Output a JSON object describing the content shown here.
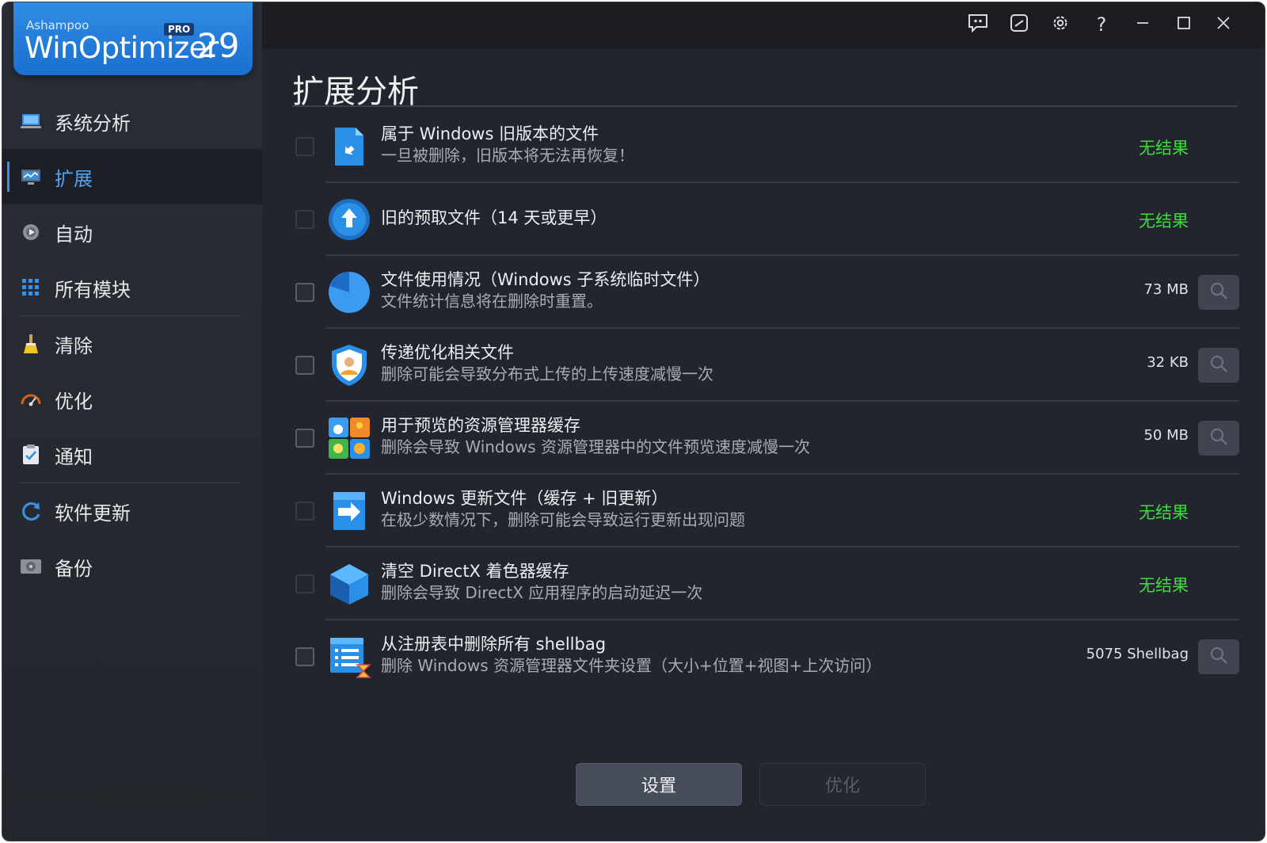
{
  "app": {
    "vendor": "Ashampoo",
    "product": "WinOptimizer",
    "edition": "PRO",
    "version": "29"
  },
  "colors": {
    "accent": "#3d8ee8",
    "no_result": "#3fdc3f",
    "background": "#22252d"
  },
  "sidebar": {
    "items": [
      {
        "label": "系统分析",
        "icon": "laptop-icon",
        "active": false
      },
      {
        "label": "扩展",
        "icon": "monitor-chart-icon",
        "active": true
      },
      {
        "label": "自动",
        "icon": "gear-play-icon",
        "active": false
      },
      {
        "label": "所有模块",
        "icon": "grid-icon",
        "active": false
      },
      {
        "label": "清除",
        "icon": "broom-icon",
        "active": false
      },
      {
        "label": "优化",
        "icon": "speedometer-icon",
        "active": false
      },
      {
        "label": "通知",
        "icon": "clipboard-check-icon",
        "active": false
      },
      {
        "label": "软件更新",
        "icon": "refresh-icon",
        "active": false
      },
      {
        "label": "备份",
        "icon": "disk-icon",
        "active": false
      }
    ]
  },
  "titlebar": {
    "buttons": [
      "feedback-icon",
      "edit-icon",
      "gear-icon",
      "help-icon",
      "minimize-icon",
      "maximize-icon",
      "close-icon"
    ],
    "help_glyph": "?"
  },
  "main": {
    "title": "扩展分析",
    "rows": [
      {
        "title": "属于 Windows 旧版本的文件",
        "desc": "一旦被删除，旧版本将无法再恢复！",
        "result": "无结果",
        "has_result": false,
        "icon": "old-windows-file-icon"
      },
      {
        "title": "旧的预取文件（14 天或更早）",
        "desc": "",
        "result": "无结果",
        "has_result": false,
        "icon": "prefetch-upload-icon"
      },
      {
        "title": "文件使用情况（Windows 子系统临时文件）",
        "desc": "文件统计信息将在删除时重置。",
        "result": "73 MB",
        "has_result": true,
        "icon": "pie-chart-icon"
      },
      {
        "title": "传递优化相关文件",
        "desc": "删除可能会导致分布式上传的上传速度减慢一次",
        "result": "32 KB",
        "has_result": true,
        "icon": "shield-user-icon"
      },
      {
        "title": "用于预览的资源管理器缓存",
        "desc": "删除会导致 Windows 资源管理器中的文件预览速度减慢一次",
        "result": "50 MB",
        "has_result": true,
        "icon": "preview-cache-icon"
      },
      {
        "title": "Windows 更新文件（缓存 + 旧更新）",
        "desc": "在极少数情况下，删除可能会导致运行更新出现问题",
        "result": "无结果",
        "has_result": false,
        "icon": "windows-update-icon"
      },
      {
        "title": "清空 DirectX 着色器缓存",
        "desc": "删除会导致 DirectX 应用程序的启动延迟一次",
        "result": "无结果",
        "has_result": false,
        "icon": "directx-cube-icon"
      },
      {
        "title": "从注册表中删除所有 shellbag",
        "desc": "删除 Windows 资源管理器文件夹设置（大小+位置+视图+上次访问）",
        "result": "5075 Shellbag",
        "has_result": true,
        "icon": "registry-list-icon"
      }
    ]
  },
  "footer": {
    "settings_label": "设置",
    "optimize_label": "优化"
  }
}
